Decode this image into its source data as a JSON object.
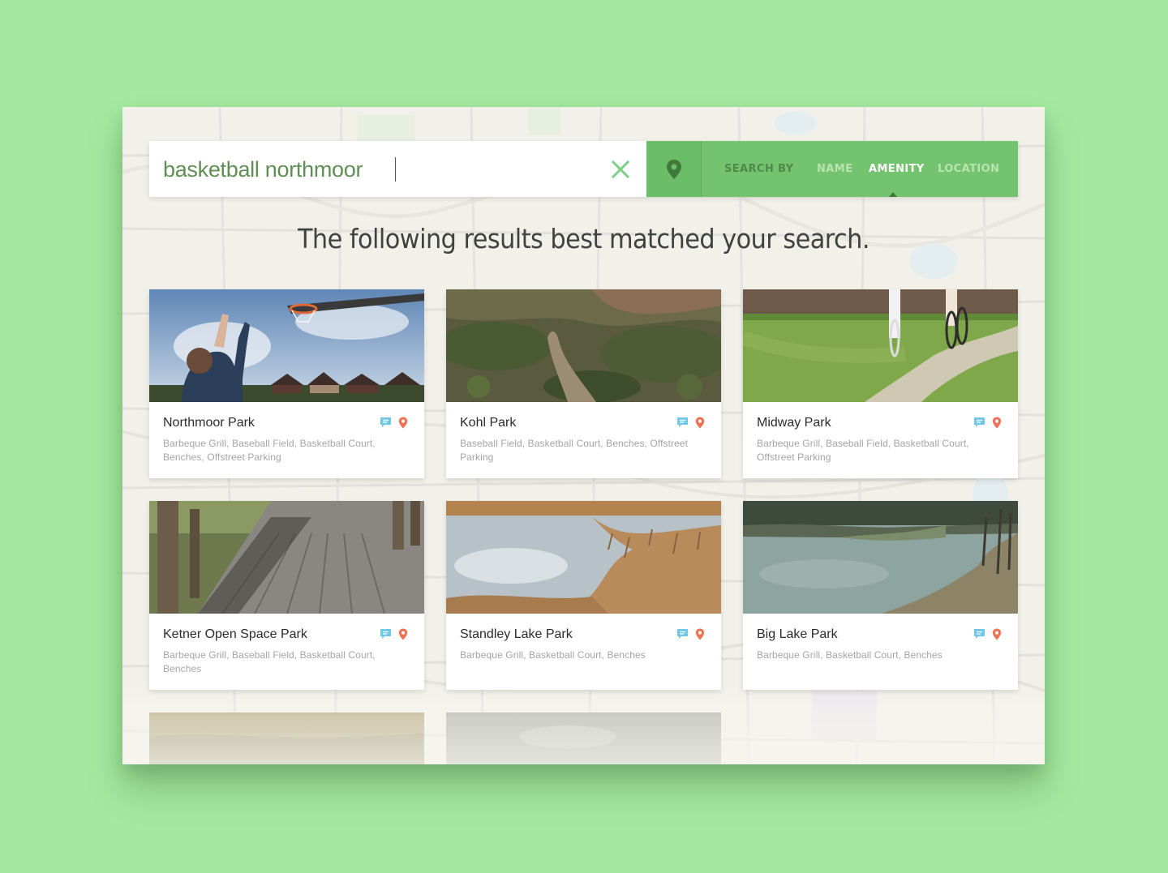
{
  "search": {
    "query": "basketball northmoor",
    "search_by_label": "SEARCH BY",
    "options": [
      "NAME",
      "AMENITY",
      "LOCATION"
    ],
    "active_option": "AMENITY"
  },
  "headline": "The following results best matched your search.",
  "colors": {
    "page_background": "#a4e9a0",
    "accent_green": "#74c36e",
    "clear_icon": "#7fcf86",
    "comment_icon": "#6fc8e8",
    "pin_icon": "#ec7357"
  },
  "results": [
    {
      "name": "Northmoor Park",
      "amenities": "Barbeque Grill, Baseball Field, Basketball Court, Benches, Offstreet Parking",
      "photo": "basketball-hoop-photo"
    },
    {
      "name": "Kohl Park",
      "amenities": "Baseball Field, Basketball Court, Benches, Offstreet Parking",
      "photo": "desert-trail-photo"
    },
    {
      "name": "Midway Park",
      "amenities": "Barbeque Grill, Baseball Field, Basketball Court, Offstreet Parking",
      "photo": "bike-path-photo"
    },
    {
      "name": "Ketner Open Space Park",
      "amenities": "Barbeque Grill, Baseball Field, Basketball Court, Benches",
      "photo": "boardwalk-photo"
    },
    {
      "name": "Standley Lake Park",
      "amenities": "Barbeque Grill, Basketball Court, Benches",
      "photo": "marsh-lake-photo"
    },
    {
      "name": "Big Lake Park",
      "amenities": "Barbeque Grill, Basketball Court, Benches",
      "photo": "river-bank-photo"
    }
  ]
}
